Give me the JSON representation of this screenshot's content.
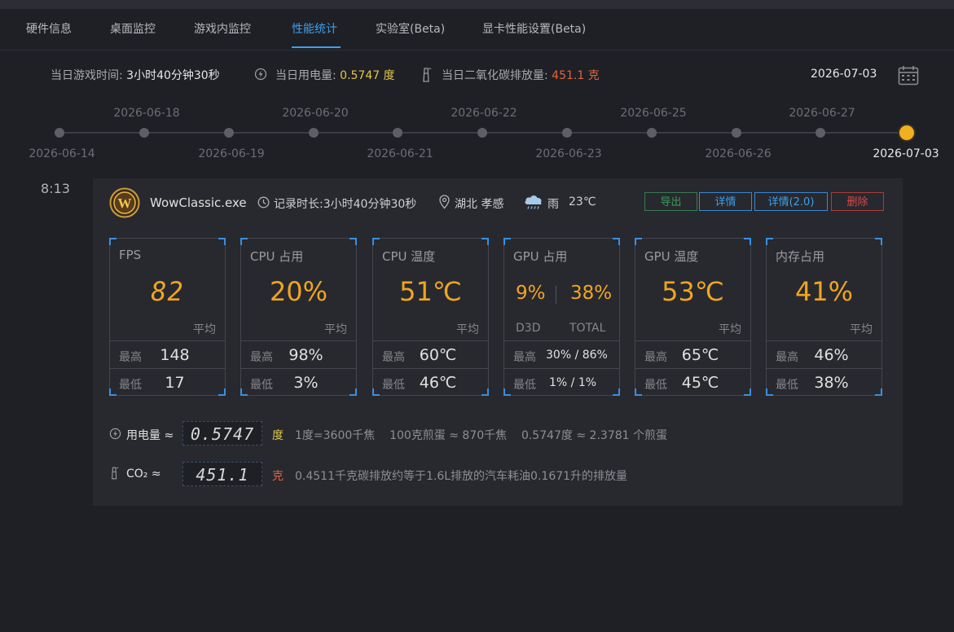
{
  "tabs": [
    {
      "label": "硬件信息"
    },
    {
      "label": "桌面监控"
    },
    {
      "label": "游戏内监控"
    },
    {
      "label": "性能统计"
    },
    {
      "label": "实验室(Beta)"
    },
    {
      "label": "显卡性能设置(Beta)"
    }
  ],
  "active_tab": "性能统计",
  "summary": {
    "play_time_label": "当日游戏时间:",
    "play_time_value": "3小时40分钟30秒",
    "power_label": "当日用电量:",
    "power_value": "0.5747 度",
    "co2_label": "当日二氧化碳排放量:",
    "co2_value": "451.1 克",
    "current_date": "2026-07-03"
  },
  "timeline": {
    "top_labels": [
      "2026-06-18",
      "2026-06-20",
      "2026-06-22",
      "2026-06-25",
      "2026-06-27"
    ],
    "bottom_labels": [
      "2026-06-14",
      "2026-06-19",
      "2026-06-21",
      "2026-06-23",
      "2026-06-26",
      "2026-07-03"
    ],
    "selected": "2026-07-03"
  },
  "session": {
    "time": "8:13",
    "app_name": "WowClassic.exe",
    "duration": "记录时长:3小时40分钟30秒",
    "location": "湖北 孝感",
    "weather": "雨",
    "temperature": "23℃",
    "buttons": {
      "export": "导出",
      "detail": "详情",
      "detail2": "详情(2.0)",
      "delete": "删除"
    }
  },
  "stats": {
    "avg_label": "平均",
    "max_label": "最高",
    "min_label": "最低",
    "fps": {
      "title": "FPS",
      "avg": "82",
      "max": "148",
      "min": "17"
    },
    "cpu_usage": {
      "title": "CPU 占用",
      "avg": "20%",
      "max": "98%",
      "min": "3%"
    },
    "cpu_temp": {
      "title": "CPU 温度",
      "avg": "51℃",
      "max": "60℃",
      "min": "46℃"
    },
    "gpu_usage": {
      "title": "GPU 占用",
      "d3d_avg": "9%",
      "total_avg": "38%",
      "d3d_label": "D3D",
      "total_label": "TOTAL",
      "max": "30%  /  86%",
      "min": "1%   /   1%"
    },
    "gpu_temp": {
      "title": "GPU 温度",
      "avg": "53℃",
      "max": "65℃",
      "min": "45℃"
    },
    "mem_usage": {
      "title": "内存占用",
      "avg": "41%",
      "max": "46%",
      "min": "38%"
    }
  },
  "energy": {
    "power_label": "用电量 ≈",
    "power_value": "0.5747",
    "power_unit": "度",
    "power_note": "1度=3600千焦    100克煎蛋 ≈ 870千焦    0.5747度 ≈ 2.3781 个煎蛋",
    "co2_label": "CO₂ ≈",
    "co2_value": "451.1",
    "co2_unit": "克",
    "co2_note": "0.4511千克碳排放约等于1.6L排放的汽车耗油0.1671升的排放量"
  },
  "colors": {
    "accent": "#3aa0f0",
    "highlight": "#f0a520",
    "power": "#e2c54a",
    "co2": "#e0643a",
    "danger": "#d64a45",
    "success": "#3a9a5a"
  }
}
